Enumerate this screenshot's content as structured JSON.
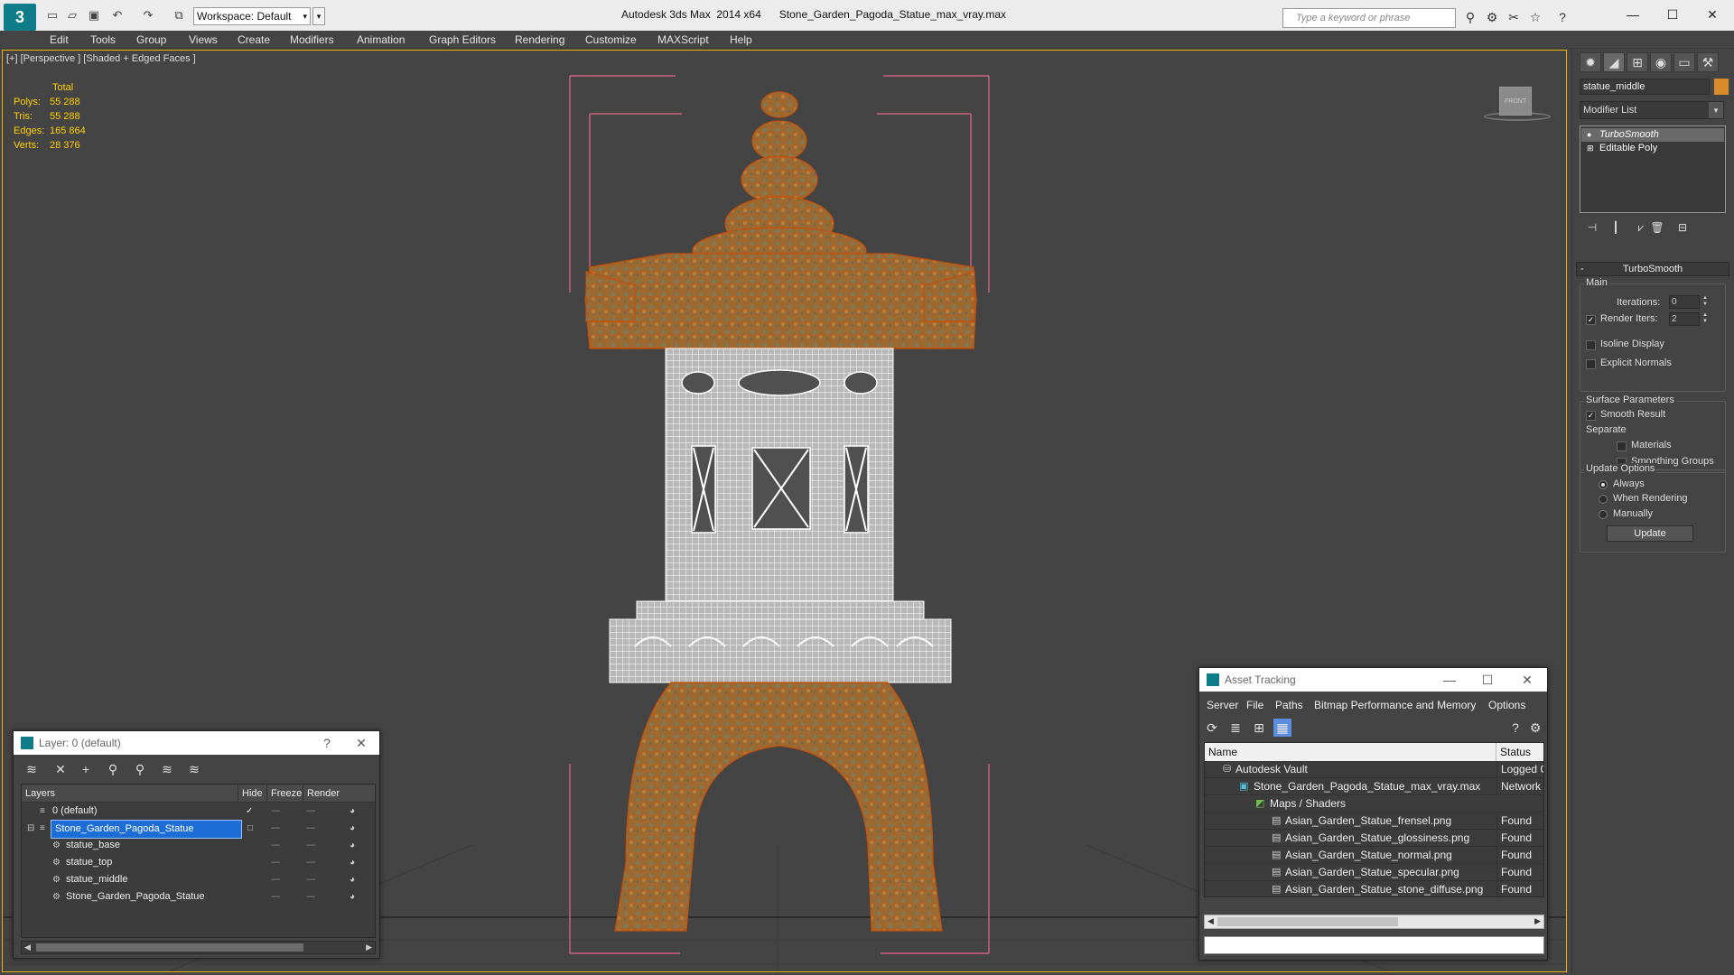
{
  "titlebar": {
    "workspace": "Workspace: Default",
    "title": "Autodesk 3ds Max  2014 x64      Stone_Garden_Pagoda_Statue_max_vray.max",
    "search_placeholder": "Type a keyword or phrase"
  },
  "menu": [
    "Edit",
    "Tools",
    "Group",
    "Views",
    "Create",
    "Modifiers",
    "Animation",
    "Graph Editors",
    "Rendering",
    "Customize",
    "MAXScript",
    "Help"
  ],
  "viewport": {
    "label": "[+] [Perspective ] [Shaded + Edged Faces ]",
    "stats": {
      "total_label": "Total",
      "rows": [
        {
          "label": "Polys:",
          "value": "55 288"
        },
        {
          "label": "Tris:",
          "value": "55 288"
        },
        {
          "label": "Edges:",
          "value": "165 864"
        },
        {
          "label": "Verts:",
          "value": "28 376"
        }
      ]
    },
    "viewcube_label": "FRONT"
  },
  "command_panel": {
    "object_name": "statue_middle",
    "object_color": "#d98a2b",
    "modifier_list": "Modifier List",
    "stack": [
      "TurboSmooth",
      "Editable Poly"
    ],
    "rollout_title": "TurboSmooth",
    "main_group": "Main",
    "iterations_label": "Iterations:",
    "iterations_value": "0",
    "render_iters_label": "Render Iters:",
    "render_iters_value": "2",
    "isoline": "Isoline Display",
    "explicit_normals": "Explicit Normals",
    "surface_group": "Surface Parameters",
    "smooth_result": "Smooth Result",
    "separate": "Separate",
    "materials": "Materials",
    "smoothing_groups": "Smoothing Groups",
    "update_group": "Update Options",
    "always": "Always",
    "when_rendering": "When Rendering",
    "manually": "Manually",
    "update_button": "Update"
  },
  "layer_dialog": {
    "title": "Layer: 0 (default)",
    "help": "?",
    "columns": [
      "Layers",
      "Hide",
      "Freeze",
      "Render"
    ],
    "rows": [
      {
        "name": "0 (default)"
      },
      {
        "name": "Stone_Garden_Pagoda_Statue"
      },
      {
        "name": "statue_base"
      },
      {
        "name": "statue_top"
      },
      {
        "name": "statue_middle"
      },
      {
        "name": "Stone_Garden_Pagoda_Statue"
      }
    ]
  },
  "asset_dialog": {
    "title": "Asset Tracking",
    "menu": [
      "Server",
      "File",
      "Paths",
      "Bitmap Performance and Memory",
      "Options"
    ],
    "columns": [
      "Name",
      "Status"
    ],
    "rows": [
      {
        "name": "Autodesk Vault",
        "status": "Logged O"
      },
      {
        "name": "Stone_Garden_Pagoda_Statue_max_vray.max",
        "status": "Network F"
      },
      {
        "name": "Maps / Shaders",
        "status": ""
      },
      {
        "name": "Asian_Garden_Statue_frensel.png",
        "status": "Found"
      },
      {
        "name": "Asian_Garden_Statue_glossiness.png",
        "status": "Found"
      },
      {
        "name": "Asian_Garden_Statue_normal.png",
        "status": "Found"
      },
      {
        "name": "Asian_Garden_Statue_specular.png",
        "status": "Found"
      },
      {
        "name": "Asian_Garden_Statue_stone_diffuse.png",
        "status": "Found"
      }
    ]
  }
}
